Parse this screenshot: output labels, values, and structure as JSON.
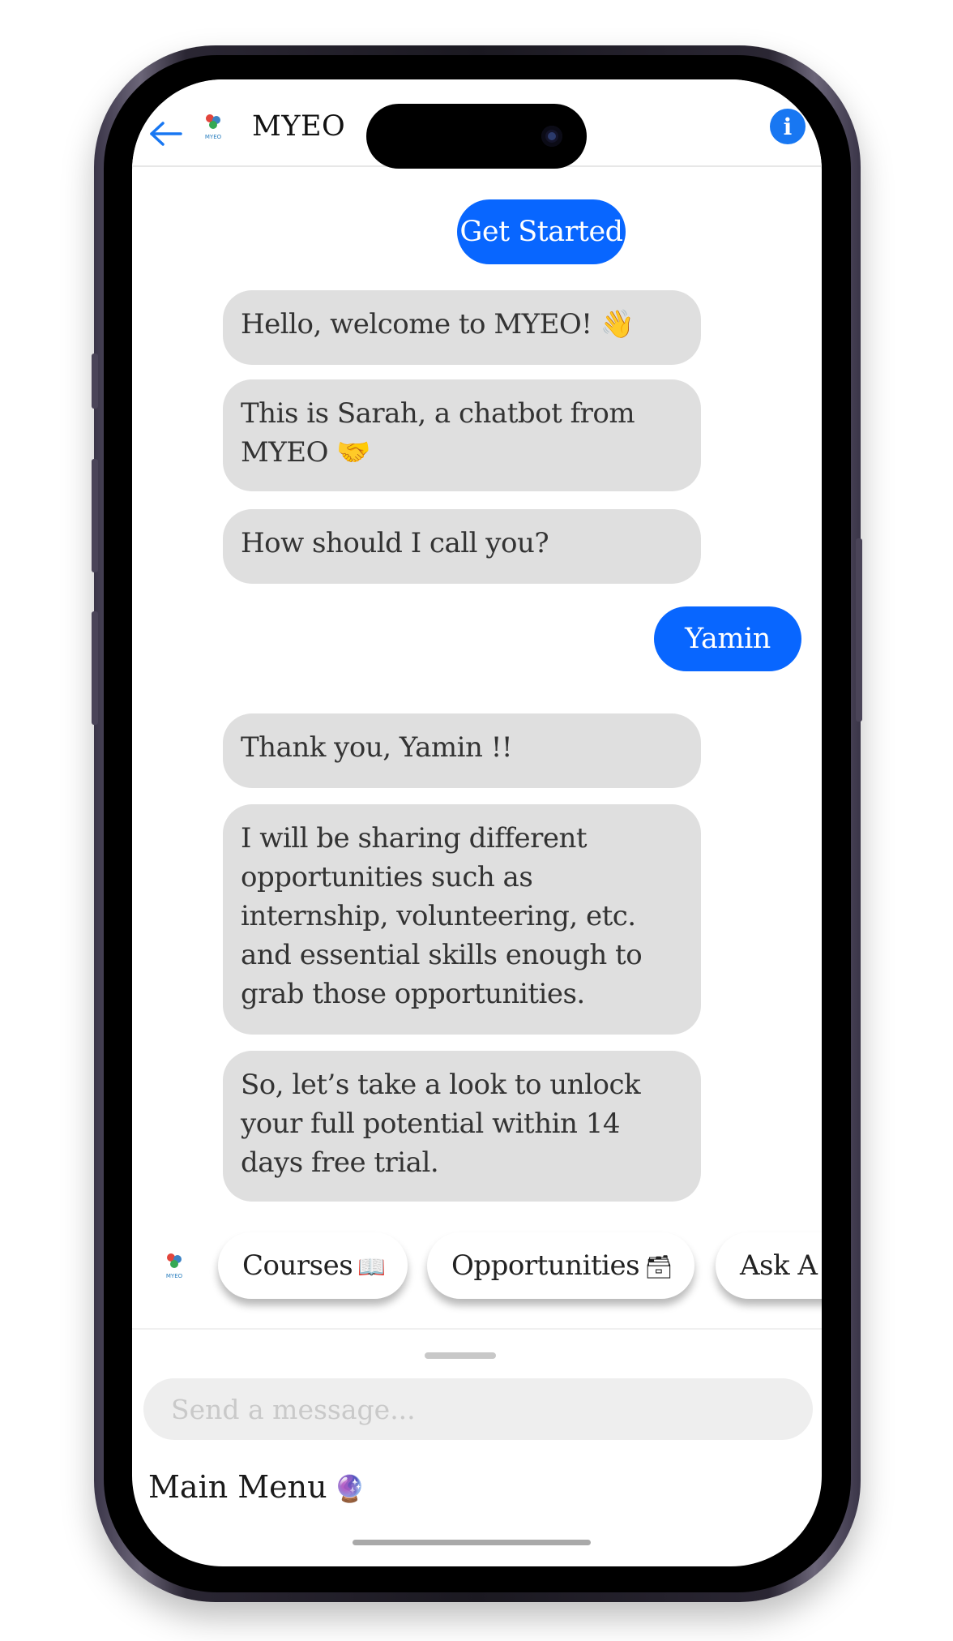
{
  "header": {
    "title": "MYEO",
    "logo_text": "MYEO",
    "info_glyph": "i"
  },
  "messages": [
    {
      "from": "user",
      "text": "Get Started"
    },
    {
      "from": "bot",
      "text": "Hello, welcome to MYEO! 👋"
    },
    {
      "from": "bot",
      "text": "This is Sarah, a chatbot from MYEO 🤝"
    },
    {
      "from": "bot",
      "text": "How should I call you?"
    },
    {
      "from": "user",
      "text": "Yamin"
    },
    {
      "from": "bot",
      "text": "Thank you, Yamin !!"
    },
    {
      "from": "bot",
      "text": "I will be sharing different opportunities such as internship, volunteering, etc. and essential skills enough to grab those opportunities."
    },
    {
      "from": "bot",
      "text": "So, let’s take a look to unlock your full potential within 14 days free trial."
    }
  ],
  "quick_replies": [
    {
      "label": "Courses",
      "emoji": "📖"
    },
    {
      "label": "Opportunities",
      "emoji": "🗃"
    },
    {
      "label": "Ask A",
      "emoji": ""
    }
  ],
  "composer": {
    "placeholder": "Send a message..."
  },
  "footer": {
    "main_menu_label": "Main Menu",
    "main_menu_emoji": "🔮"
  },
  "colors": {
    "accent": "#0866ff",
    "bot_bubble": "#dfdfdf",
    "info_button": "#1877f2"
  }
}
